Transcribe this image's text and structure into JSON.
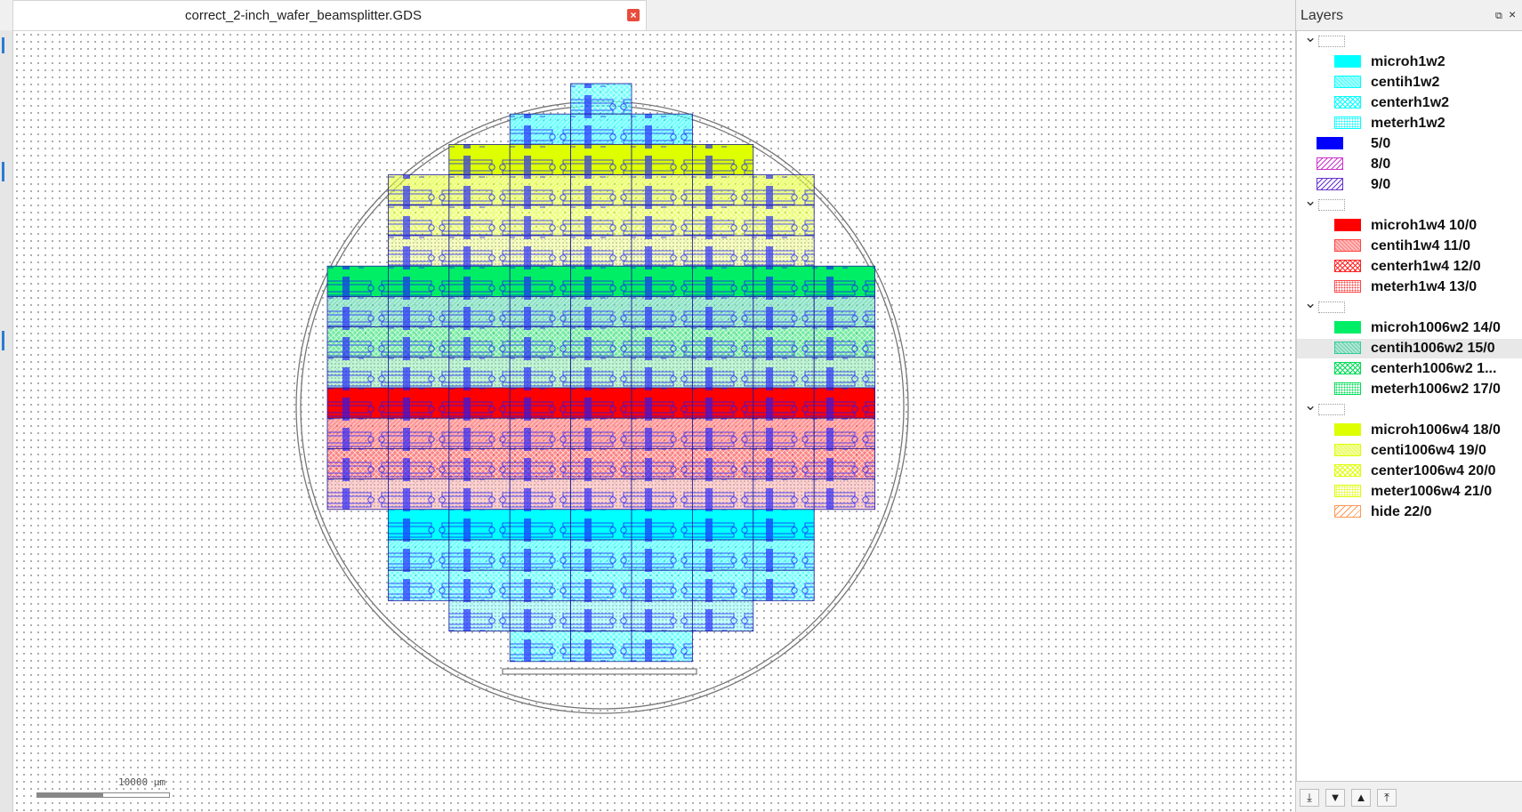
{
  "document_tab": {
    "title": "correct_2-inch_wafer_beamsplitter.GDS",
    "close_icon": "close-icon"
  },
  "scale_bar": {
    "label": "10000 µm"
  },
  "layers_panel": {
    "title": "Layers",
    "header_icons": [
      "undock-icon",
      "close-icon"
    ],
    "groups": [
      {
        "collapsed": false,
        "layers": [
          {
            "name": "microh1w2",
            "color": "#00ffff",
            "pattern": "solid"
          },
          {
            "name": "centih1w2",
            "color": "#00ffff",
            "pattern": "hatch-light"
          },
          {
            "name": "centerh1w2",
            "color": "#00ffff",
            "pattern": "cross"
          },
          {
            "name": "meterh1w2",
            "color": "#00ffff",
            "pattern": "dots"
          },
          {
            "name": "5/0",
            "color": "#0000ff",
            "pattern": "solid"
          },
          {
            "name": "8/0",
            "color": "#cc33cc",
            "pattern": "diag"
          },
          {
            "name": "9/0",
            "color": "#6633cc",
            "pattern": "diag"
          }
        ]
      },
      {
        "collapsed": false,
        "layers": [
          {
            "name": "microh1w4 10/0",
            "color": "#ff0000",
            "pattern": "solid"
          },
          {
            "name": "centih1w4 11/0",
            "color": "#ff4444",
            "pattern": "hatch-light"
          },
          {
            "name": "centerh1w4 12/0",
            "color": "#ff2222",
            "pattern": "cross"
          },
          {
            "name": "meterh1w4 13/0",
            "color": "#ff4444",
            "pattern": "dots"
          }
        ]
      },
      {
        "collapsed": false,
        "layers": [
          {
            "name": "microh1006w2 14/0",
            "color": "#00ee66",
            "pattern": "solid"
          },
          {
            "name": "centih1006w2 15/0",
            "color": "#33cc99",
            "pattern": "hatch-light"
          },
          {
            "name": "centerh1006w2 1...",
            "color": "#00dd55",
            "pattern": "cross"
          },
          {
            "name": "meterh1006w2 17/0",
            "color": "#00dd55",
            "pattern": "dots"
          }
        ]
      },
      {
        "collapsed": false,
        "layers": [
          {
            "name": "microh1006w4 18/0",
            "color": "#ddff00",
            "pattern": "solid"
          },
          {
            "name": "centi1006w4 19/0",
            "color": "#ddff00",
            "pattern": "hatch-light"
          },
          {
            "name": "center1006w4 20/0",
            "color": "#ddff00",
            "pattern": "cross"
          },
          {
            "name": "meter1006w4 21/0",
            "color": "#ddff00",
            "pattern": "dots"
          },
          {
            "name": "hide 22/0",
            "color": "#ff9955",
            "pattern": "diag-light"
          }
        ]
      }
    ],
    "footer_buttons": [
      {
        "name": "move-to-bottom-button",
        "icon": "arrow-bottom-icon",
        "glyph": "⤓"
      },
      {
        "name": "move-down-button",
        "icon": "arrow-down-icon",
        "glyph": "▼"
      },
      {
        "name": "move-up-button",
        "icon": "arrow-up-icon",
        "glyph": "▲"
      },
      {
        "name": "move-to-top-button",
        "icon": "arrow-top-icon",
        "glyph": "⤒"
      }
    ]
  },
  "wafer": {
    "row_spans": [
      {
        "first_col": 4,
        "last_col": 4,
        "color": "#00ffff",
        "fill": "cross"
      },
      {
        "first_col": 3,
        "last_col": 5,
        "color": "#00ffff",
        "fill": "hatch"
      },
      {
        "first_col": 2,
        "last_col": 6,
        "color": "#ddff00",
        "fill": "solid"
      },
      {
        "first_col": 1,
        "last_col": 7,
        "color": "#ddff00",
        "fill": "hatch"
      },
      {
        "first_col": 1,
        "last_col": 7,
        "color": "#ddff00",
        "fill": "cross"
      },
      {
        "first_col": 1,
        "last_col": 7,
        "color": "#ddff00",
        "fill": "dots"
      },
      {
        "first_col": 0,
        "last_col": 8,
        "color": "#00ee66",
        "fill": "solid"
      },
      {
        "first_col": 0,
        "last_col": 8,
        "color": "#33cc99",
        "fill": "hatch"
      },
      {
        "first_col": 0,
        "last_col": 8,
        "color": "#00dd55",
        "fill": "cross"
      },
      {
        "first_col": 0,
        "last_col": 8,
        "color": "#00dd55",
        "fill": "dots"
      },
      {
        "first_col": 0,
        "last_col": 8,
        "color": "#ff0000",
        "fill": "solid"
      },
      {
        "first_col": 0,
        "last_col": 8,
        "color": "#ff4444",
        "fill": "hatch"
      },
      {
        "first_col": 0,
        "last_col": 8,
        "color": "#ff2222",
        "fill": "cross"
      },
      {
        "first_col": 0,
        "last_col": 8,
        "color": "#ff4444",
        "fill": "dots"
      },
      {
        "first_col": 1,
        "last_col": 7,
        "color": "#00ffff",
        "fill": "solid"
      },
      {
        "first_col": 1,
        "last_col": 7,
        "color": "#00ffff",
        "fill": "hatch"
      },
      {
        "first_col": 1,
        "last_col": 7,
        "color": "#00ffff",
        "fill": "cross"
      },
      {
        "first_col": 2,
        "last_col": 6,
        "color": "#00ffff",
        "fill": "dots"
      },
      {
        "first_col": 3,
        "last_col": 5,
        "color": "#00ffff",
        "fill": "cross"
      }
    ]
  }
}
